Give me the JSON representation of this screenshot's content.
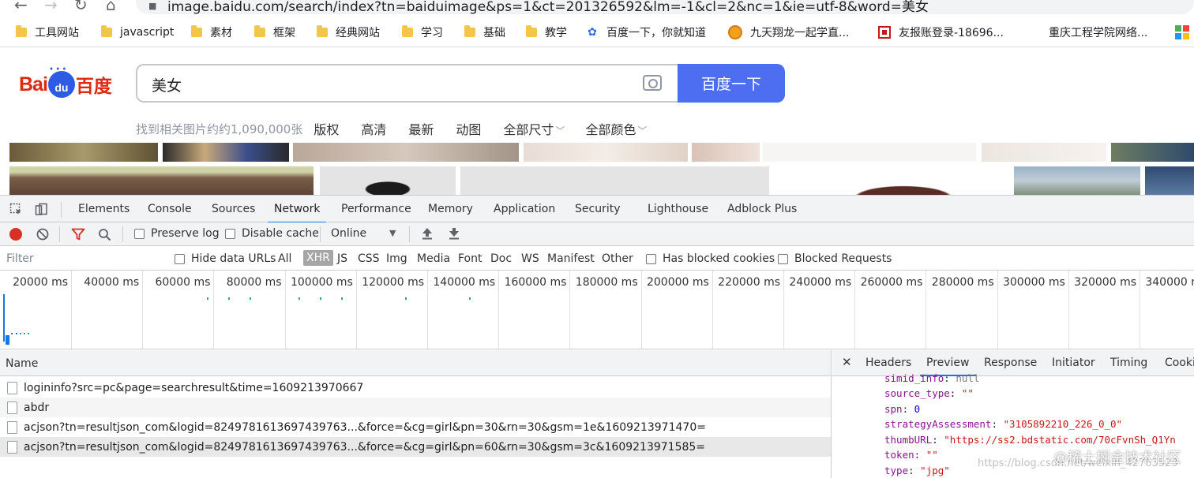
{
  "browser": {
    "url": "image.baidu.com/search/index?tn=baiduimage&ps=1&ct=201326592&lm=-1&cl=2&nc=1&ie=utf-8&word=美女",
    "bookmarks": [
      {
        "label": "工具网站",
        "icon": "folder-icon"
      },
      {
        "label": "javascript",
        "icon": "folder-icon"
      },
      {
        "label": "素材",
        "icon": "folder-icon"
      },
      {
        "label": "框架",
        "icon": "folder-icon"
      },
      {
        "label": "经典网站",
        "icon": "folder-icon"
      },
      {
        "label": "学习",
        "icon": "folder-icon"
      },
      {
        "label": "基础",
        "icon": "folder-icon"
      },
      {
        "label": "教学",
        "icon": "folder-icon"
      },
      {
        "label": "百度一下，你就知道",
        "icon": "baidu-paw-icon"
      },
      {
        "label": "九天翔龙一起学直...",
        "icon": "site-favicon-icon"
      },
      {
        "label": "友报账登录-18696...",
        "icon": "site-favicon-icon"
      },
      {
        "label": "重庆工程学院网络...",
        "icon": "none"
      }
    ]
  },
  "baidu": {
    "logo_left": "Bai",
    "logo_du": "du",
    "logo_right": "百度",
    "query": "美女",
    "search_button": "百度一下",
    "result_count": "找到相关图片约约1,090,000张",
    "filters": [
      "版权",
      "高清",
      "最新",
      "动图",
      "全部尺寸",
      "全部颜色"
    ]
  },
  "devtools": {
    "tabs": [
      "Elements",
      "Console",
      "Sources",
      "Network",
      "Performance",
      "Memory",
      "Application",
      "Security",
      "Lighthouse",
      "Adblock Plus"
    ],
    "active_tab": "Network",
    "toolbar": {
      "preserve_log": "Preserve log",
      "disable_cache": "Disable cache",
      "throttle": "Online"
    },
    "filter": {
      "placeholder": "Filter",
      "hide_data_urls": "Hide data URLs",
      "types": [
        "All",
        "XHR",
        "JS",
        "CSS",
        "Img",
        "Media",
        "Font",
        "Doc",
        "WS",
        "Manifest",
        "Other"
      ],
      "active_type": "XHR",
      "blocked_cookies": "Has blocked cookies",
      "blocked_requests": "Blocked Requests"
    },
    "timeline_ticks": [
      "20000 ms",
      "40000 ms",
      "60000 ms",
      "80000 ms",
      "100000 ms",
      "120000 ms",
      "140000 ms",
      "160000 ms",
      "180000 ms",
      "200000 ms",
      "220000 ms",
      "240000 ms",
      "260000 ms",
      "280000 ms",
      "300000 ms",
      "320000 ms",
      "340000 ms"
    ],
    "requests_header": "Name",
    "requests": [
      "logininfo?src=pc&page=searchresult&time=1609213970667",
      "abdr",
      "acjson?tn=resultjson_com&logid=8249781613697439763...&force=&cg=girl&pn=30&rn=30&gsm=1e&1609213971470=",
      "acjson?tn=resultjson_com&logid=8249781613697439763...&force=&cg=girl&pn=60&rn=30&gsm=3c&1609213971585="
    ],
    "detail_tabs": [
      "Headers",
      "Preview",
      "Response",
      "Initiator",
      "Timing",
      "Cooki"
    ],
    "active_detail_tab": "Preview",
    "preview": [
      {
        "key": "simid_info",
        "sep": ": ",
        "value": "null",
        "type": "null"
      },
      {
        "key": "source_type",
        "sep": ": ",
        "value": "\"\"",
        "type": "string"
      },
      {
        "key": "spn",
        "sep": ": ",
        "value": "0",
        "type": "number"
      },
      {
        "key": "strategyAssessment",
        "sep": ": ",
        "value": "\"3105892210_226_0_0\"",
        "type": "string"
      },
      {
        "key": "thumbURL",
        "sep": ": ",
        "value": "\"https://ss2.bdstatic.com/70cFvnSh_Q1Yn",
        "type": "string"
      },
      {
        "key": "token",
        "sep": ": ",
        "value": "\"\"",
        "type": "string"
      },
      {
        "key": "type",
        "sep": ": ",
        "value": "\"jpg\"",
        "type": "string"
      }
    ]
  },
  "watermark": "@稀土掘金技术社区",
  "watermark_url": "https://blog.csdn.net/weixin_42763523"
}
